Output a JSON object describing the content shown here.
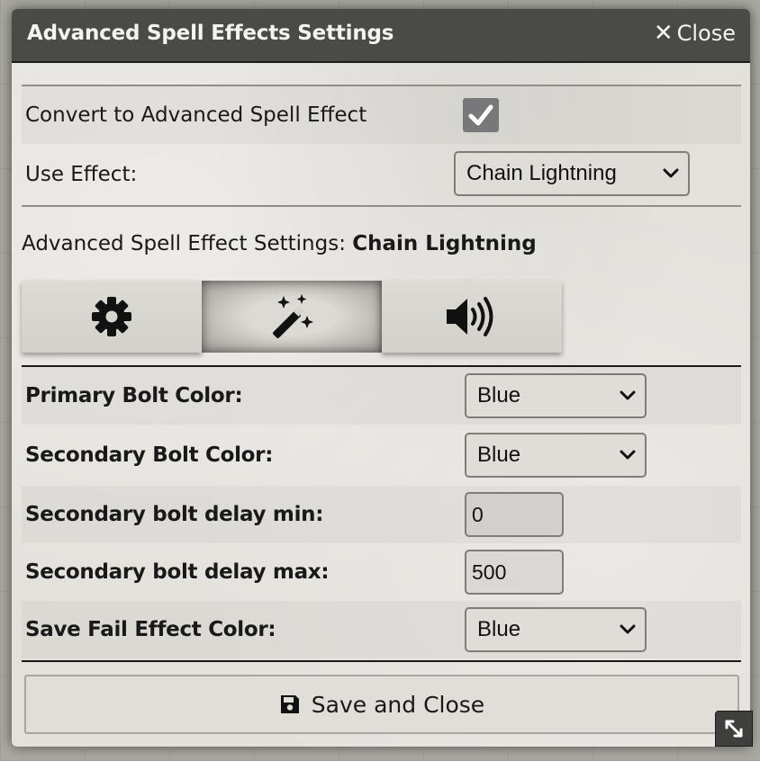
{
  "window": {
    "title": "Advanced Spell Effects Settings",
    "close_label": "Close"
  },
  "convert": {
    "label": "Convert to Advanced Spell Effect",
    "checked": true
  },
  "use_effect": {
    "label": "Use Effect:",
    "value": "Chain Lightning"
  },
  "settings_heading": {
    "prefix": "Advanced Spell Effect Settings: ",
    "effect_name": "Chain Lightning"
  },
  "tabs": [
    {
      "icon": "gear-icon",
      "active": false
    },
    {
      "icon": "magic-wand-icon",
      "active": true
    },
    {
      "icon": "volume-icon",
      "active": false
    }
  ],
  "fields": {
    "primary_bolt_color": {
      "label": "Primary Bolt Color:",
      "value": "Blue"
    },
    "secondary_bolt_color": {
      "label": "Secondary Bolt Color:",
      "value": "Blue"
    },
    "secondary_delay_min": {
      "label": "Secondary bolt delay min:",
      "value": "0"
    },
    "secondary_delay_max": {
      "label": "Secondary bolt delay max:",
      "value": "500"
    },
    "save_fail_color": {
      "label": "Save Fail Effect Color:",
      "value": "Blue"
    }
  },
  "save_button": {
    "label": "Save and Close",
    "icon": "floppy-disk-icon"
  },
  "resize_handle": {
    "icon": "resize-icon"
  },
  "colors": {
    "titlebar": "#4a4a46",
    "panel": "#e3e1dc",
    "checkbox": "#78787a"
  }
}
